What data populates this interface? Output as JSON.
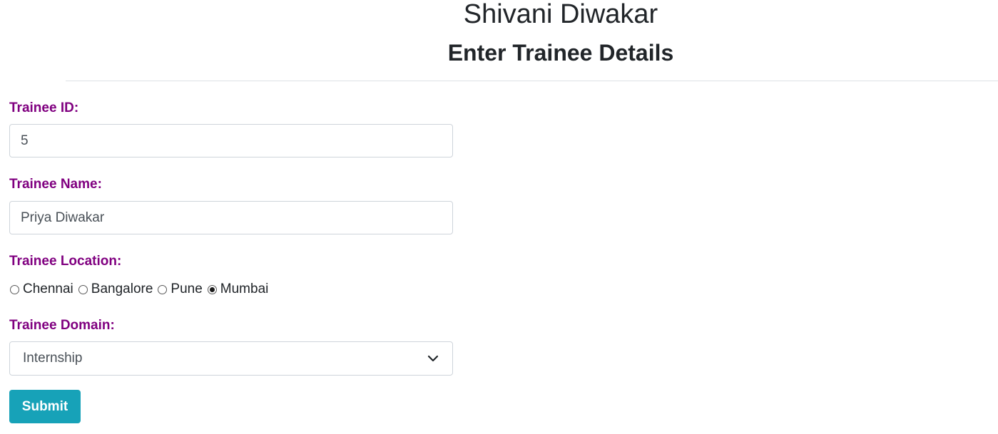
{
  "header": {
    "app_title": "Shivani Diwakar",
    "form_heading": "Enter Trainee Details"
  },
  "form": {
    "trainee_id": {
      "label": "Trainee ID:",
      "value": "5"
    },
    "trainee_name": {
      "label": "Trainee Name:",
      "value": "Priya Diwakar"
    },
    "trainee_location": {
      "label": "Trainee Location:",
      "options": [
        "Chennai",
        "Bangalore",
        "Pune",
        "Mumbai"
      ],
      "selected": "Mumbai"
    },
    "trainee_domain": {
      "label": "Trainee Domain:",
      "selected": "Internship",
      "icon": "chevron-down-icon"
    },
    "submit_label": "Submit"
  },
  "colors": {
    "label": "#800080",
    "submit_bg": "#17a2b8",
    "text": "#212529",
    "input_border": "#ced4da"
  }
}
